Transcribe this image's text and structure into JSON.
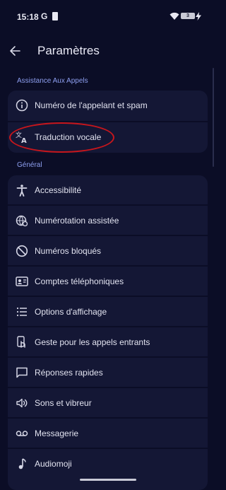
{
  "status_bar": {
    "time": "15:18",
    "app_indicator": "G",
    "battery_level": "3"
  },
  "header": {
    "title": "Paramètres",
    "back_icon": "arrow-left-icon"
  },
  "sections": [
    {
      "title": "Assistance Aux Appels",
      "items": [
        {
          "label": "Numéro de l'appelant et spam",
          "icon": "info-icon"
        },
        {
          "label": "Traduction vocale",
          "icon": "translate-icon"
        }
      ]
    },
    {
      "title": "Général",
      "items": [
        {
          "label": "Accessibilité",
          "icon": "accessibility-icon"
        },
        {
          "label": "Numérotation assistée",
          "icon": "assisted-dialing-icon"
        },
        {
          "label": "Numéros bloqués",
          "icon": "block-icon"
        },
        {
          "label": "Comptes téléphoniques",
          "icon": "phone-account-icon"
        },
        {
          "label": "Options d'affichage",
          "icon": "list-icon"
        },
        {
          "label": "Geste pour les appels entrants",
          "icon": "gesture-icon"
        },
        {
          "label": "Réponses rapides",
          "icon": "message-icon"
        },
        {
          "label": "Sons et vibreur",
          "icon": "volume-icon"
        },
        {
          "label": "Messagerie",
          "icon": "voicemail-icon"
        },
        {
          "label": "Audiomoji",
          "icon": "music-note-icon"
        }
      ]
    }
  ],
  "colors": {
    "background": "#0b0d26",
    "card": "#141735",
    "section_header": "#8e9ff0",
    "highlight": "#c8161c"
  }
}
